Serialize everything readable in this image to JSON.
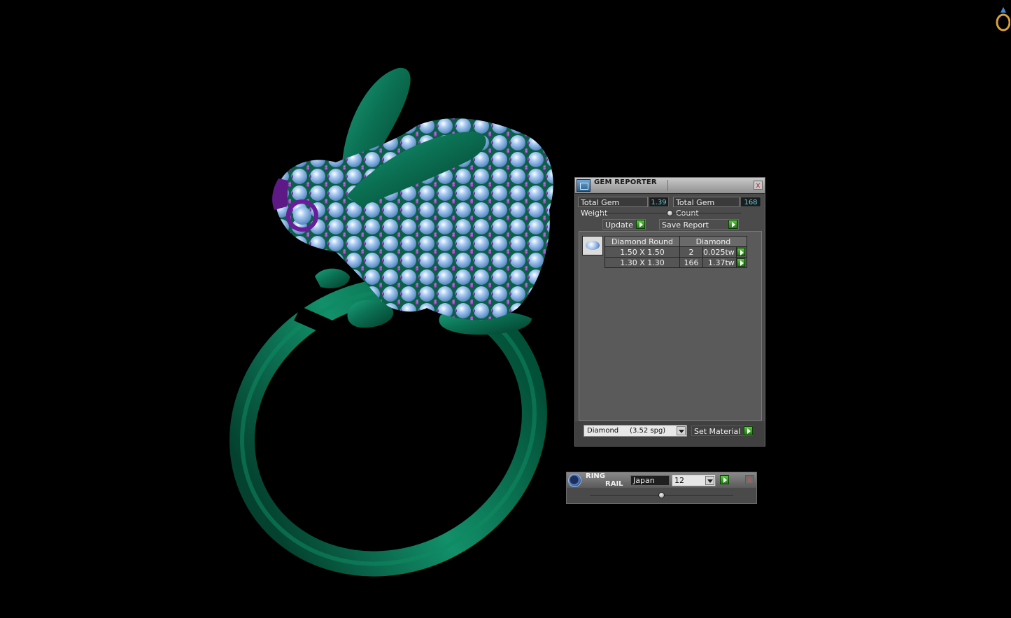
{
  "gem_reporter": {
    "title": "GEM REPORTER",
    "close_glyph": "x",
    "total_weight_label": "Total Gem Weight",
    "total_weight_value": "1.39",
    "total_count_label": "Total Gem Count",
    "total_count_value": "168",
    "update_label": "Update",
    "save_report_label": "Save Report",
    "table": {
      "headers": [
        "Diamond Round",
        "Diamond"
      ],
      "rows": [
        {
          "size": "1.50 X 1.50",
          "count": "2",
          "weight": "0.025tw"
        },
        {
          "size": "1.30 X 1.30",
          "count": "166",
          "weight": "1.37tw"
        }
      ]
    },
    "material_select": "Diamond     (3.52 spg)",
    "set_material_label": "Set Material"
  },
  "ring_rail": {
    "title_line1": "RING",
    "title_line2": "RAIL",
    "country_value": "Japan",
    "size_value": "12",
    "close_glyph": "x"
  },
  "colors": {
    "background": "#000000",
    "ring_metal": "#0b6f52",
    "gem_stone": "#7fb0e8",
    "prong": "#6b1f9a",
    "accent_value": "#55d6e8",
    "go_button": "#3aa726"
  },
  "icons": [
    "gem-reporter-icon",
    "close-icon",
    "go-arrow-icon",
    "gem-thumbnail-icon",
    "chevron-down-icon",
    "ring-rail-icon",
    "ring-logo-icon"
  ]
}
